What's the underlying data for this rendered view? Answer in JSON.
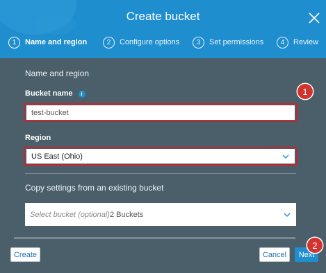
{
  "dialog": {
    "title": "Create bucket",
    "steps": [
      {
        "num": "1",
        "label": "Name and region"
      },
      {
        "num": "2",
        "label": "Configure options"
      },
      {
        "num": "3",
        "label": "Set permissions"
      },
      {
        "num": "4",
        "label": "Review"
      }
    ],
    "active_step": 1
  },
  "form": {
    "section_title": "Name and region",
    "bucket_name_label": "Bucket name",
    "info_icon": "i",
    "bucket_name_value": "test-bucket",
    "region_label": "Region",
    "region_value": "US East (Ohio)",
    "copy_title": "Copy settings from an existing bucket",
    "copy_placeholder": "Select bucket (optional)",
    "copy_count": "2 Buckets"
  },
  "buttons": {
    "create": "Create",
    "cancel": "Cancel",
    "next": "Next"
  },
  "annotations": [
    {
      "label": "1"
    },
    {
      "label": "2"
    }
  ],
  "colors": {
    "header": "#1f8ecf",
    "body": "#4b5f6b",
    "highlight": "#c4262e",
    "marker": "#d2332f"
  },
  "icons": {
    "close": "close-icon",
    "info": "info-icon",
    "chevron": "chevron-down-icon"
  }
}
